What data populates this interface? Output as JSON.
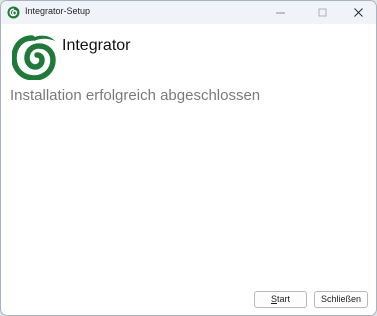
{
  "window": {
    "title": "Integrator-Setup",
    "controls": {
      "minimize": "minimize",
      "maximize": "maximize",
      "close": "close"
    }
  },
  "header": {
    "product_name": "Integrator",
    "logo_icon": "green-swirl-logo",
    "accent_color": "#1f7a3a"
  },
  "main": {
    "status_text": "Installation erfolgreich abgeschlossen"
  },
  "buttons": {
    "start": {
      "mnemonic": "S",
      "rest": "tart"
    },
    "close": {
      "label": "Schließen"
    }
  }
}
